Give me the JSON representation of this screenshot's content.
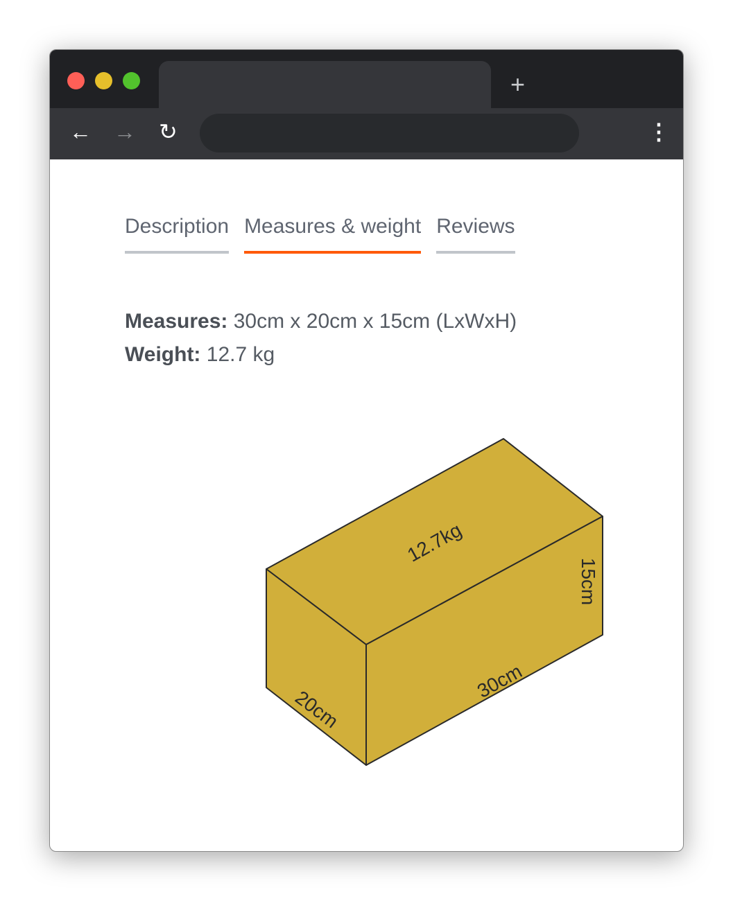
{
  "browser": {
    "traffic_lights": [
      "#ff5f57",
      "#e6bf2b",
      "#52c22d"
    ],
    "new_tab_label": "+",
    "back_icon": "arrow-left-icon",
    "forward_icon": "arrow-right-icon",
    "reload_icon": "reload-icon",
    "menu_icon": "kebab-menu-icon",
    "address_value": ""
  },
  "tabs": [
    {
      "label": "Description",
      "active": false
    },
    {
      "label": "Measures & weight",
      "active": true
    },
    {
      "label": "Reviews",
      "active": false
    }
  ],
  "accent": "#ff5a0a",
  "details": {
    "measures_label": "Measures:",
    "measures_value": " 30cm x 20cm x 15cm (LxWxH)",
    "weight_label": "Weight:",
    "weight_value": " 12.7 kg"
  },
  "box": {
    "color": "#d1af3a",
    "weight_label": "12.7kg",
    "height_label": "15cm",
    "length_label": "30cm",
    "width_label": "20cm"
  }
}
